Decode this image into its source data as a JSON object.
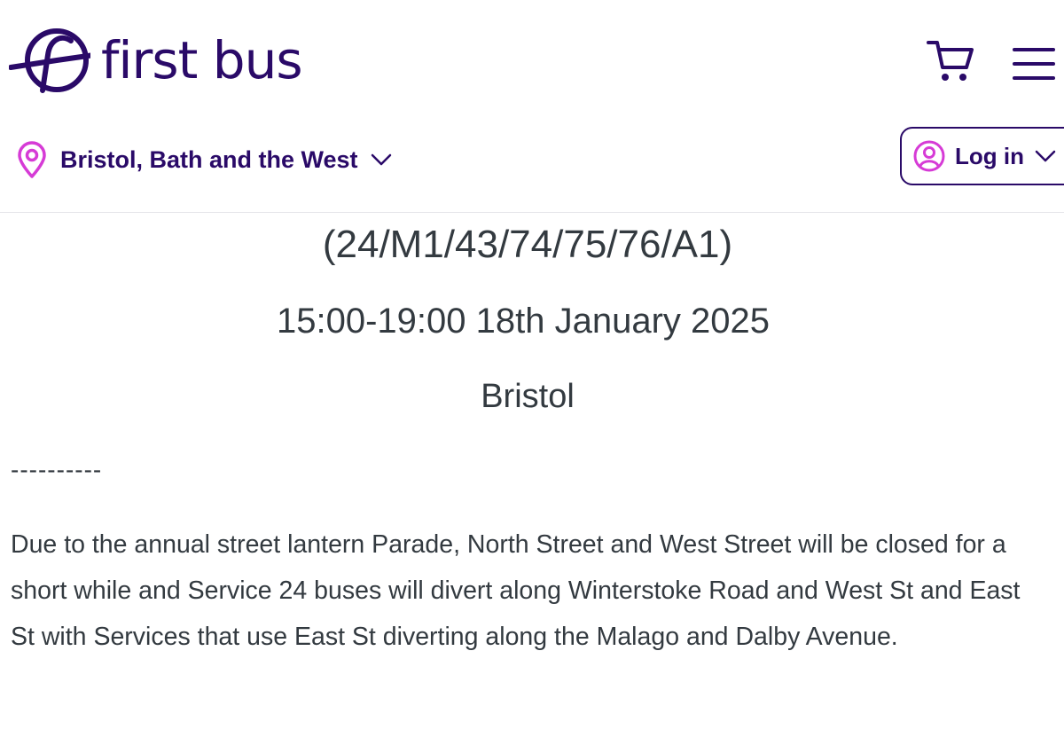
{
  "header": {
    "brand_name": "first bus",
    "cart_icon": "cart-icon",
    "menu_icon": "hamburger-menu-icon",
    "region": {
      "label": "Bristol, Bath and the West",
      "icon": "location-pin-icon"
    },
    "login": {
      "label": "Log in",
      "icon": "user-avatar-icon"
    }
  },
  "notice": {
    "routes": "(24/M1/43/74/75/76/A1)",
    "datetime": "15:00-19:00 18th January 2025",
    "location": "Bristol",
    "divider": "----------",
    "body": "Due to the annual street lantern Parade, North Street and West Street will be closed for a short while and Service 24 buses will divert along Winterstoke Road and West St and East St with Services that use East St diverting along the Malago and Dalby Avenue."
  },
  "colors": {
    "brand_purple": "#2a0a68",
    "accent_magenta": "#d63bd6",
    "text_gray": "#333a40"
  }
}
